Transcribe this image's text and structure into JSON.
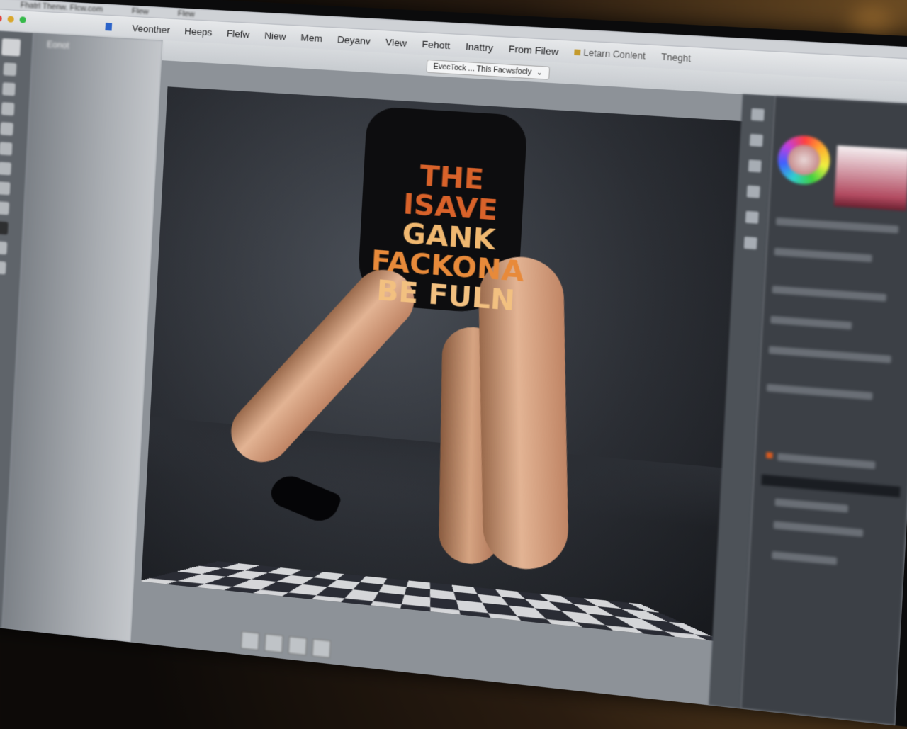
{
  "window": {
    "title": "Fhatrl Thenw. Flcw.com",
    "title_extra": [
      "Flew",
      "Flew"
    ]
  },
  "menubar": {
    "items": [
      "Veonther",
      "Heeps",
      "Flefw",
      "Niew",
      "Mem",
      "Deyanv",
      "View",
      "Fehott",
      "Inattry",
      "From Filew"
    ],
    "extra": [
      "Letarn Conlent",
      "Tneght"
    ]
  },
  "document_tab": {
    "label": "EvecTock ... This Facwsfocly"
  },
  "left_panel": {
    "header": "Eonot"
  },
  "canvas": {
    "shirt_text": [
      "THE ISAVE",
      "GANK",
      "FACKONA",
      "BE FULN"
    ]
  },
  "colors": {
    "accent_orange": "#d8622a",
    "shirt": "#0d0d0f",
    "panel_bg": "#3c4046"
  }
}
